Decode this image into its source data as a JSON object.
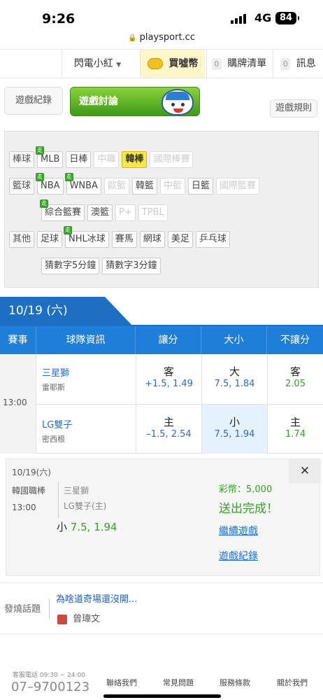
{
  "status": {
    "time": "9:26",
    "network": "4G",
    "battery": "84",
    "url": "playsport.cc"
  },
  "nav": {
    "user": "閃電小紅",
    "buy_coin": "買噓幣",
    "cart_count": "0",
    "cart_label": "購牌清單",
    "msg_count": "0",
    "msg_label": "訊息"
  },
  "actions": {
    "record": "遊戲紀錄",
    "discuss": "遊戲討論",
    "rules": "遊戲規則"
  },
  "categories": {
    "baseball": {
      "label": "棒球",
      "items": [
        "MLB",
        "日棒",
        "中職",
        "韓棒",
        "國際棒賽"
      ]
    },
    "basketball": {
      "label": "籃球",
      "items": [
        "NBA",
        "WNBA",
        "歐籃",
        "韓籃",
        "中籃",
        "日籃",
        "國際籃賽"
      ]
    },
    "basketball2": {
      "items": [
        "綜合籃賽",
        "澳籃",
        "P+",
        "TPBL"
      ]
    },
    "other": {
      "label": "其他",
      "items": [
        "足球",
        "NHL冰球",
        "賽馬",
        "網球",
        "美足",
        "乒乓球"
      ]
    },
    "other2": {
      "items": [
        "猜數字5分鐘",
        "猜數字3分鐘"
      ]
    }
  },
  "new_badge": "走",
  "date_tab": "10/19 (六)",
  "table": {
    "headers": [
      "賽事",
      "球隊資訊",
      "讓分",
      "大小",
      "不讓分"
    ],
    "time": "13:00",
    "rows": [
      {
        "team": "三星獅",
        "pitcher": "雷耶斯",
        "spread_side": "客",
        "spread_odds": "+1.5, 1.49",
        "ou_side": "大",
        "ou_odds": "7.5, 1.84",
        "ml_side": "客",
        "ml_odds": "2.05"
      },
      {
        "team": "LG雙子",
        "pitcher": "密西根",
        "spread_side": "主",
        "spread_odds": "–1.5, 2.54",
        "ou_side": "小",
        "ou_odds": "7.5, 1.94",
        "ml_side": "主",
        "ml_odds": "1.74"
      }
    ]
  },
  "panel": {
    "date": "10/19(六)",
    "league": "韓國職棒",
    "time": "13:00",
    "team1": "三星獅",
    "team2": "LG雙子(主)",
    "pick_side": "小",
    "pick_odds": "7.5, 1.94",
    "coin_label": "彩幣：5,000",
    "done": "送出完成！",
    "continue": "繼續遊戲",
    "record": "遊戲紀錄",
    "close": "✕"
  },
  "hot": {
    "label": "發燒話題",
    "title": "為啥道奇場還沒開...",
    "author": "曾瑋文"
  },
  "footer": {
    "service_label": "客服電話 09:30 ~ 24:00",
    "phone": "07–9700123",
    "links": [
      "聯絡我們",
      "常見問題",
      "服務條款",
      "關於我們"
    ]
  },
  "colors": {
    "header_blue": "#1f7fd8",
    "green": "#37a027",
    "highlight": "#ffe64a"
  }
}
